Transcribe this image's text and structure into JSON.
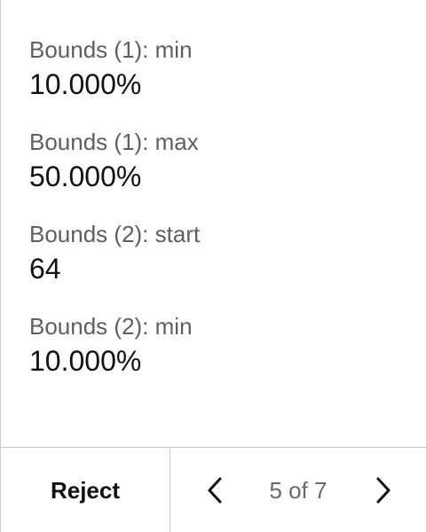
{
  "fields": [
    {
      "label": "Bounds (1): min",
      "value": "10.000%"
    },
    {
      "label": "Bounds (1): max",
      "value": "50.000%"
    },
    {
      "label": "Bounds (2): start",
      "value": "64"
    },
    {
      "label": "Bounds (2): min",
      "value": "10.000%"
    }
  ],
  "footer": {
    "reject_label": "Reject",
    "pager_text": "5 of 7",
    "prev_icon": "chevron-left-icon",
    "next_icon": "chevron-right-icon"
  }
}
